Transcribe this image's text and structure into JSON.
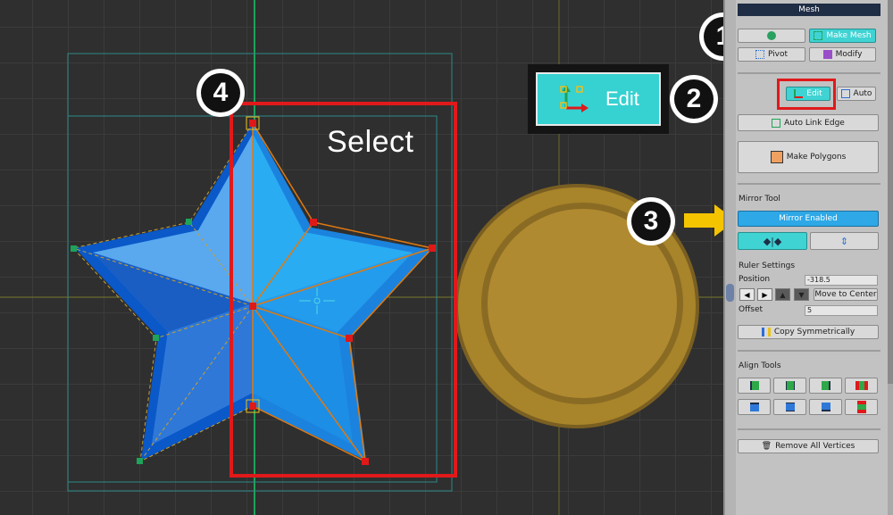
{
  "viewport": {
    "select_label": "Select",
    "edit_zoom_label": "Edit"
  },
  "steps": [
    "1",
    "2",
    "3",
    "4"
  ],
  "panel": {
    "title": "Mesh",
    "make_mesh_label": "Make Mesh",
    "pivot_label": "Pivot",
    "modify_label": "Modify",
    "edit_label": "Edit",
    "auto_label": "Auto",
    "auto_link_edge_label": "Auto Link Edge",
    "make_polygons_label": "Make Polygons",
    "mirror_tool_label": "Mirror Tool",
    "mirror_enabled_label": "Mirror Enabled",
    "ruler_settings_label": "Ruler Settings",
    "position_label": "Position",
    "position_value": "-318.5",
    "move_to_center_label": "Move to Center",
    "offset_label": "Offset",
    "offset_value": "5",
    "copy_symmetrically_label": "Copy Symmetrically",
    "align_tools_label": "Align Tools",
    "remove_all_vertices_label": "Remove All Vertices"
  },
  "colors": {
    "accent_cyan": "#3fd3d3",
    "mirror_blue": "#2ea8e6",
    "highlight_red": "#e0191b",
    "arrow_yellow": "#f5c400",
    "star_blue": "#1e8fe8",
    "coin_gold": "#a8842a"
  }
}
